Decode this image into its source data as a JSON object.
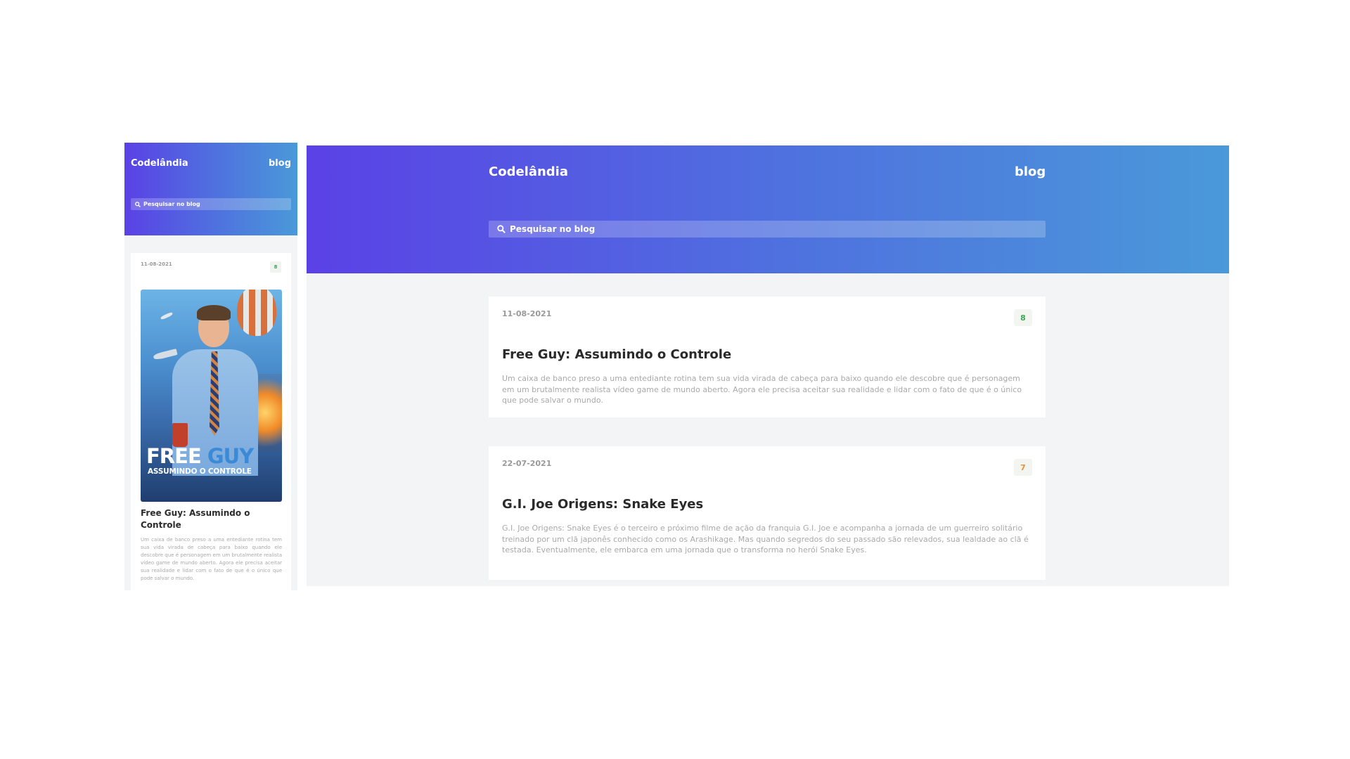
{
  "site": {
    "logo": "Codelândia",
    "nav_label": "blog",
    "search_placeholder": "Pesquisar no blog"
  },
  "colors": {
    "header_gradient_start": "#5a41e6",
    "header_gradient_end": "#4a99d9",
    "page_background": "#f3f4f6",
    "rating_green": "#3aa75a",
    "rating_orange": "#e8913a"
  },
  "mobile": {
    "post": {
      "date": "11-08-2021",
      "rating": "8",
      "poster_title_main": "FREE",
      "poster_title_accent": "GUY",
      "poster_subtitle": "ASSUMINDO O CONTROLE",
      "title": "Free Guy: Assumindo o Controle",
      "description": "Um caixa de banco preso a uma entediante rotina tem sua vida virada de cabeça para baixo quando ele descobre que é personagem em um brutalmente realista vídeo game de mundo aberto. Agora ele precisa aceitar sua realidade e lidar com o fato de que é o único que pode salvar o mundo."
    }
  },
  "desktop": {
    "posts": [
      {
        "date": "11-08-2021",
        "rating": "8",
        "rating_color": "#3aa75a",
        "title": "Free Guy: Assumindo o Controle",
        "description": "Um caixa de banco preso a uma entediante rotina tem sua vida virada de cabeça para baixo quando ele descobre que é personagem em um brutalmente realista vídeo game de mundo aberto. Agora ele precisa aceitar sua realidade e lidar com o fato de que é o único que pode salvar o mundo."
      },
      {
        "date": "22-07-2021",
        "rating": "7",
        "rating_color": "#e8913a",
        "title": "G.I. Joe Origens: Snake Eyes",
        "description": "G.I. Joe Origens: Snake Eyes é o terceiro e próximo filme de ação da franquia G.I. Joe e acompanha a jornada de um guerreiro solitário treinado por um clã japonês conhecido como os Arashikage. Mas quando segredos do seu passado são relevados, sua lealdade ao clã é testada. Eventualmente, ele embarca em uma jornada que o transforma no herói Snake Eyes."
      }
    ]
  }
}
